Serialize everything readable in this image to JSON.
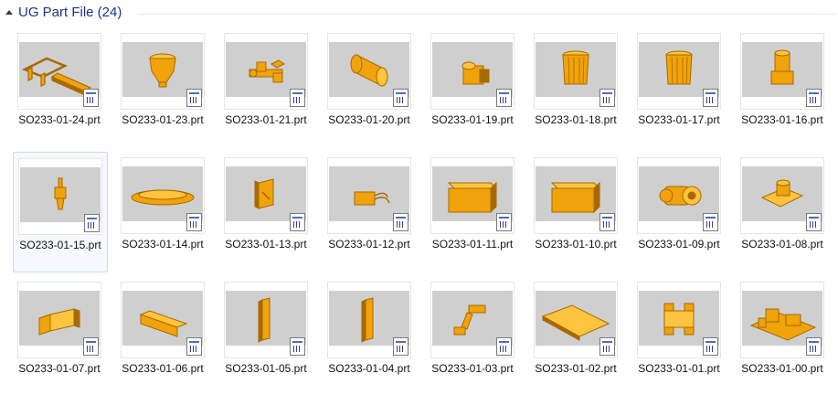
{
  "group": {
    "title": "UG Part File (24)"
  },
  "files": [
    {
      "name": "SO233-01-24.prt",
      "shape": "frame"
    },
    {
      "name": "SO233-01-23.prt",
      "shape": "funnel"
    },
    {
      "name": "SO233-01-21.prt",
      "shape": "assembly-small"
    },
    {
      "name": "SO233-01-20.prt",
      "shape": "drum"
    },
    {
      "name": "SO233-01-19.prt",
      "shape": "block-cylinder"
    },
    {
      "name": "SO233-01-18.prt",
      "shape": "cup"
    },
    {
      "name": "SO233-01-17.prt",
      "shape": "cup"
    },
    {
      "name": "SO233-01-16.prt",
      "shape": "post-box"
    },
    {
      "name": "SO233-01-15.prt",
      "shape": "spindle"
    },
    {
      "name": "SO233-01-14.prt",
      "shape": "disc"
    },
    {
      "name": "SO233-01-13.prt",
      "shape": "panel"
    },
    {
      "name": "SO233-01-12.prt",
      "shape": "connector"
    },
    {
      "name": "SO233-01-11.prt",
      "shape": "box"
    },
    {
      "name": "SO233-01-10.prt",
      "shape": "box"
    },
    {
      "name": "SO233-01-09.prt",
      "shape": "motor"
    },
    {
      "name": "SO233-01-08.prt",
      "shape": "base-cylinder"
    },
    {
      "name": "SO233-01-07.prt",
      "shape": "bracket"
    },
    {
      "name": "SO233-01-06.prt",
      "shape": "tray"
    },
    {
      "name": "SO233-01-05.prt",
      "shape": "angle"
    },
    {
      "name": "SO233-01-04.prt",
      "shape": "angle"
    },
    {
      "name": "SO233-01-03.prt",
      "shape": "arm"
    },
    {
      "name": "SO233-01-02.prt",
      "shape": "plate"
    },
    {
      "name": "SO233-01-01.prt",
      "shape": "gantry"
    },
    {
      "name": "SO233-01-00.prt",
      "shape": "machine"
    }
  ],
  "selected_index": 8,
  "colors": {
    "part": "#f0a30a",
    "part_dark": "#a86a00",
    "part_light": "#ffc43d",
    "view_bg": "#cfcfcf"
  }
}
